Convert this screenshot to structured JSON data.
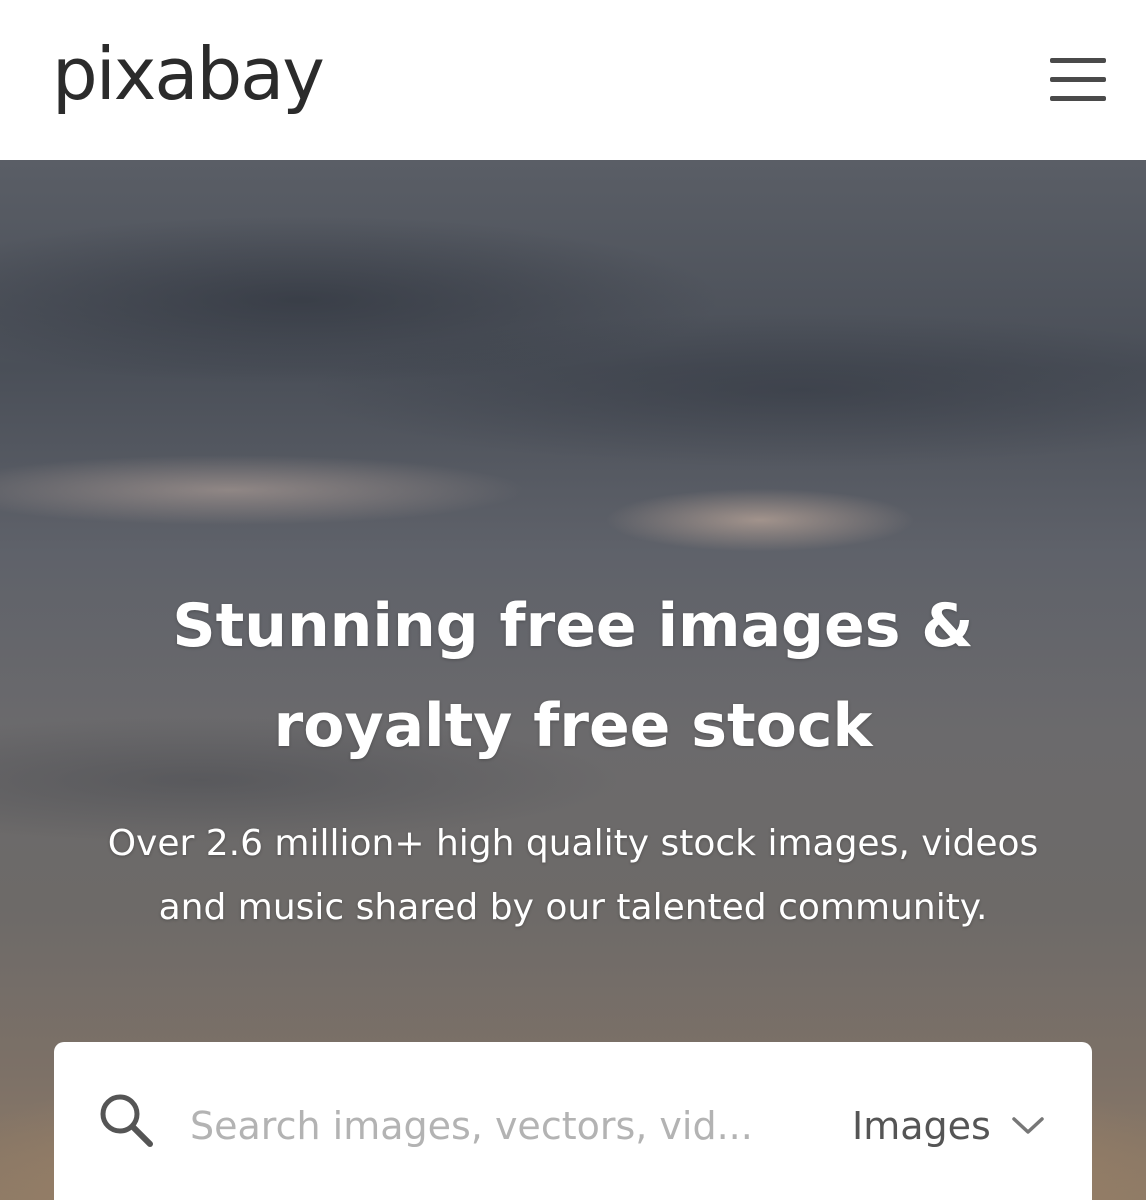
{
  "header": {
    "logo_text": "pixabay",
    "menu_icon": "hamburger-menu-icon"
  },
  "hero": {
    "title_line1": "Stunning free images &",
    "title_line2": "royalty free stock",
    "subtitle_line1": "Over 2.6 million+ high quality stock images, videos",
    "subtitle_line2": "and music shared by our talented community."
  },
  "search": {
    "icon": "search-icon",
    "placeholder": "Search images, vectors, vid...",
    "value": "",
    "type_selected": "Images",
    "type_icon": "chevron-down-icon"
  },
  "colors": {
    "logo": "#2b2b2b",
    "menu": "#4a4a4a",
    "hero_text": "#ffffff",
    "placeholder": "#b3b3b3",
    "select_text": "#555555"
  }
}
